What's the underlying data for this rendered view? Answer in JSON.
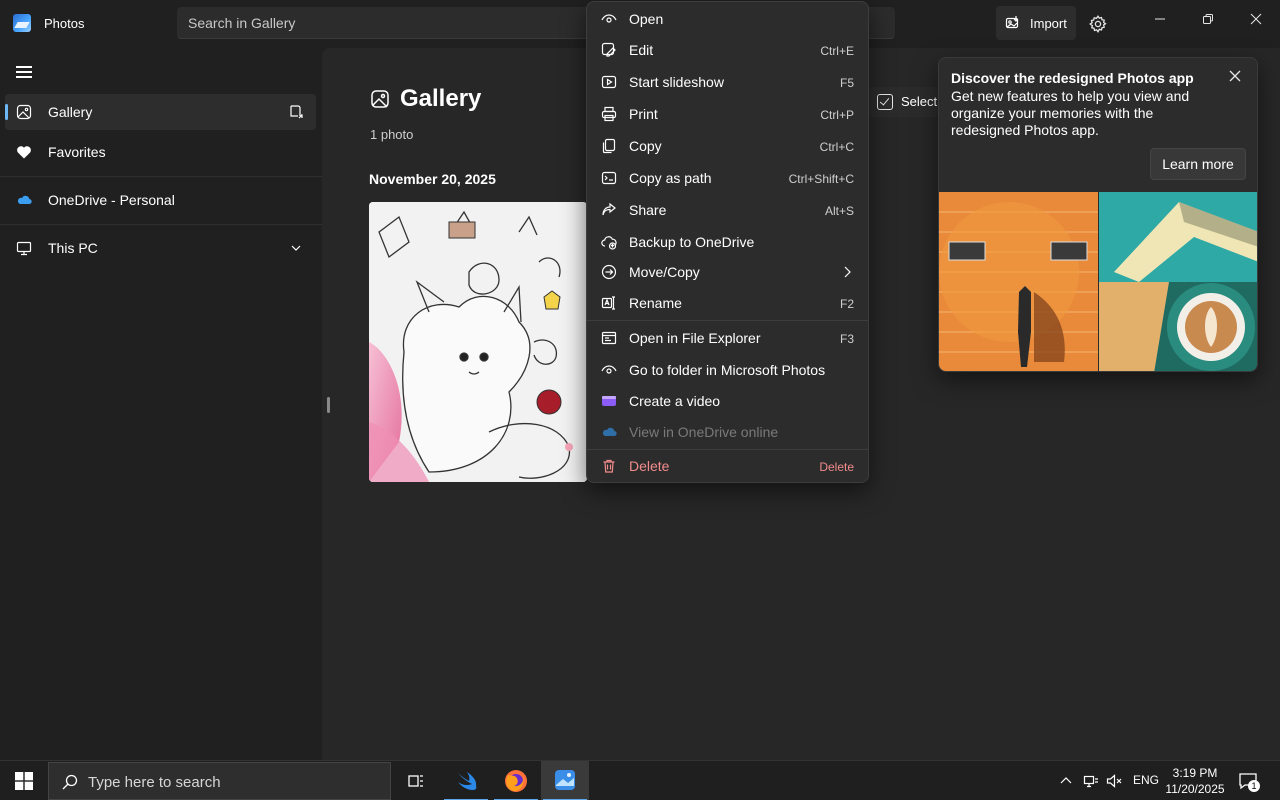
{
  "app": {
    "title": "Photos"
  },
  "search": {
    "placeholder": "Search in Gallery"
  },
  "toolbar": {
    "import_label": "Import"
  },
  "sidebar": {
    "items": [
      {
        "label": "Gallery"
      },
      {
        "label": "Favorites"
      },
      {
        "label": "OneDrive - Personal"
      },
      {
        "label": "This PC"
      }
    ]
  },
  "main": {
    "title": "Gallery",
    "count": "1 photo",
    "date_header": "November 20, 2025",
    "select_label": "Select"
  },
  "tip": {
    "title": "Discover the redesigned Photos app",
    "body": "Get new features to help you view and organize your memories with the redesigned Photos app.",
    "button": "Learn more"
  },
  "context_menu": {
    "items": [
      {
        "label": "Open",
        "shortcut": ""
      },
      {
        "label": "Edit",
        "shortcut": "Ctrl+E"
      },
      {
        "label": "Start slideshow",
        "shortcut": "F5"
      },
      {
        "label": "Print",
        "shortcut": "Ctrl+P"
      },
      {
        "label": "Copy",
        "shortcut": "Ctrl+C"
      },
      {
        "label": "Copy as path",
        "shortcut": "Ctrl+Shift+C"
      },
      {
        "label": "Share",
        "shortcut": "Alt+S"
      },
      {
        "label": "Backup to OneDrive",
        "shortcut": ""
      },
      {
        "label": "Move/Copy",
        "shortcut": ""
      },
      {
        "label": "Rename",
        "shortcut": "F2"
      },
      {
        "label": "Open in File Explorer",
        "shortcut": "F3"
      },
      {
        "label": "Go to folder in Microsoft Photos",
        "shortcut": ""
      },
      {
        "label": "Create a video",
        "shortcut": ""
      },
      {
        "label": "View in OneDrive online",
        "shortcut": ""
      },
      {
        "label": "Delete",
        "shortcut": "Delete"
      }
    ]
  },
  "taskbar": {
    "search_placeholder": "Type here to search",
    "lang": "ENG",
    "time": "3:19 PM",
    "date": "11/20/2025",
    "notification_count": "1"
  },
  "colors": {
    "accent": "#6cb8f6",
    "danger": "#f28b8b",
    "background": "#202020"
  }
}
